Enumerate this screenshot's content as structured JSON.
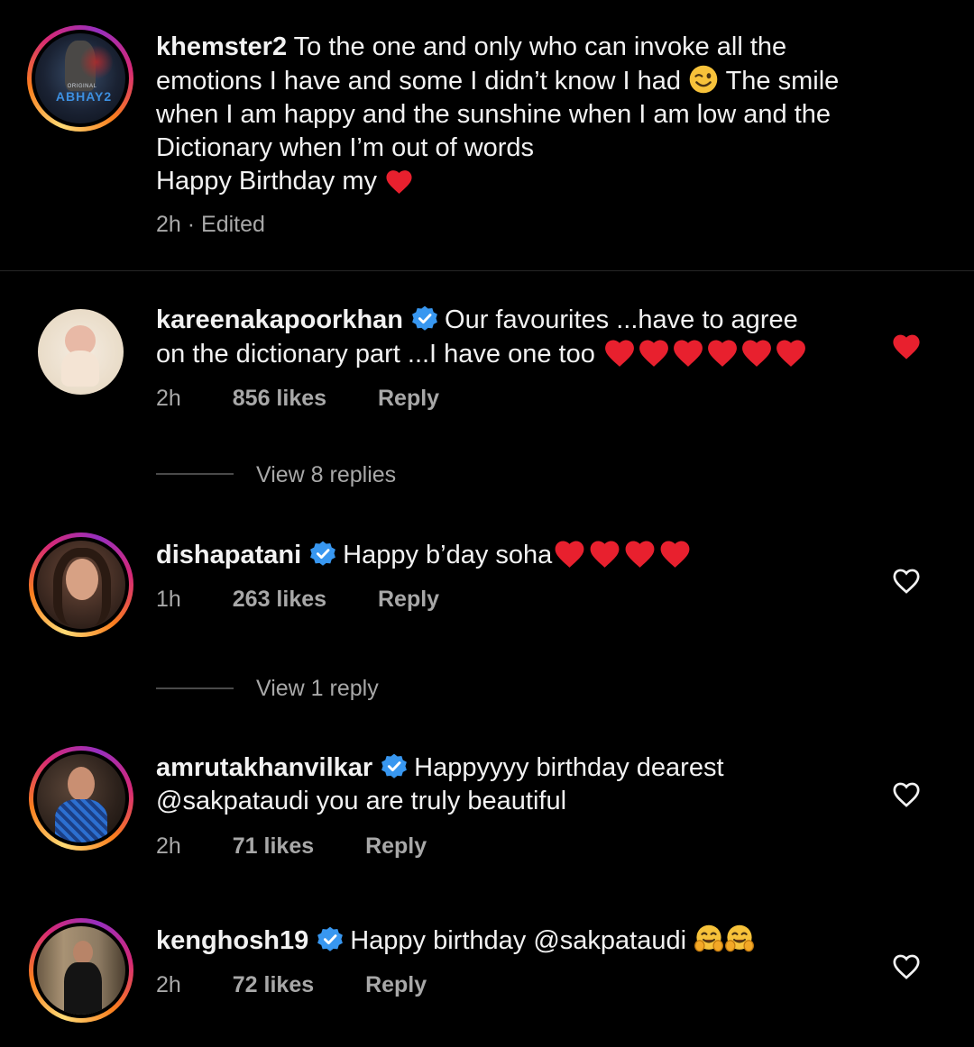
{
  "comments": [
    {
      "username": "khemster2",
      "text_lines": [
        "To the one and only who can invoke all the",
        "emotions I have and some I didn’t know I had",
        "The smile",
        "when I am happy and the sunshine when I am low and the",
        "Dictionary when I’m out of words",
        "Happy Birthday my"
      ],
      "avatar_text_small": "ORIGINAL",
      "avatar_text_big": "ABHAY2",
      "time": "2h · Edited"
    },
    {
      "username": "kareenakapoorkhan",
      "verified": true,
      "text_lines": [
        "Our favourites ...have to agree",
        "on the dictionary part ...I have one too"
      ],
      "heart_count": 6,
      "time": "2h",
      "likes": "856 likes",
      "reply": "Reply",
      "liked": true,
      "view_replies": "View 8 replies"
    },
    {
      "username": "dishapatani",
      "verified": true,
      "text_lines": [
        "Happy b’day soha"
      ],
      "heart_count": 4,
      "time": "1h",
      "likes": "263 likes",
      "reply": "Reply",
      "liked": false,
      "view_replies": "View 1 reply"
    },
    {
      "username": "amrutakhanvilkar",
      "verified": true,
      "text_lines": [
        "Happyyyy birthday dearest",
        "@sakpataudi you are truly beautiful"
      ],
      "time": "2h",
      "likes": "71 likes",
      "reply": "Reply",
      "liked": false
    },
    {
      "username": "kenghosh19",
      "verified": true,
      "text_lines": [
        "Happy birthday @sakpataudi"
      ],
      "time": "2h",
      "likes": "72 likes",
      "reply": "Reply",
      "liked": false
    }
  ],
  "colors": {
    "background": "#000000",
    "text": "#f2f2f2",
    "muted": "#a8a8a8",
    "verified_blue": "#3897f0",
    "heart_red": "#ed4956"
  },
  "icons": [
    "verified-badge-icon",
    "heart-icon",
    "heart-outline-icon",
    "winking-face-emoji",
    "hugging-face-emoji"
  ]
}
